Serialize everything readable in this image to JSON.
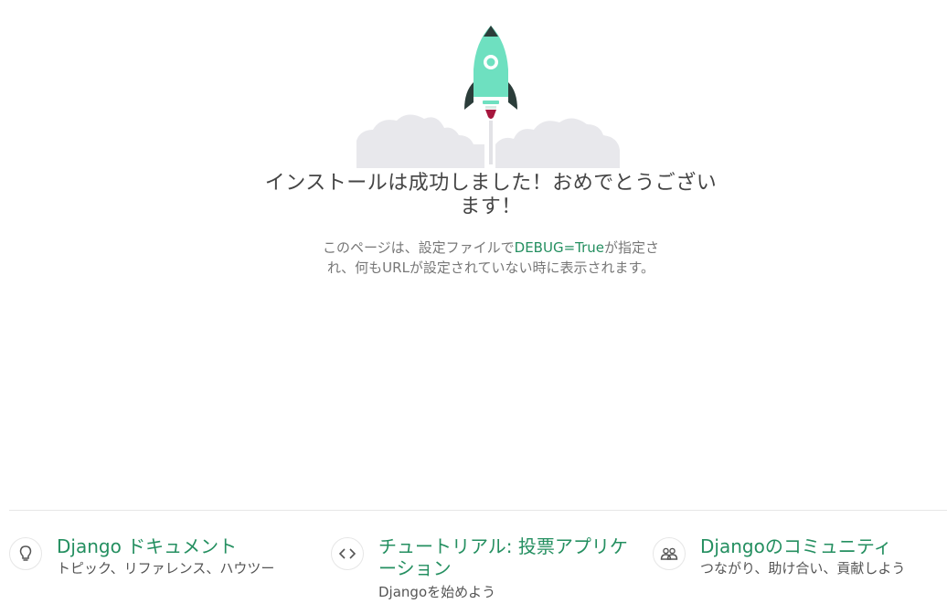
{
  "hero": {
    "icon": "rocket-icon",
    "rocket_body_color": "#6ee0c0",
    "rocket_fin_color": "#2b3d3a",
    "flame_color": "#a6163d",
    "cloud_color": "#e8e8ec"
  },
  "title": {
    "line1": "インストールは成功しました！おめでとうござい",
    "line2": "ます！"
  },
  "subtitle": {
    "part1": "このページは、設定ファイルで",
    "code": "DEBUG=True",
    "part2": "が指定さ",
    "line2": "れ、何もURLが設定されていない時に表示されます。"
  },
  "links": [
    {
      "icon": "lightbulb-icon",
      "title": "Django ドキュメント",
      "description": "トピック、リファレンス、ハウツー"
    },
    {
      "icon": "code-icon",
      "title_line1": "チュートリアル: 投票アプリケ",
      "title_line2": "ーション",
      "description": "Djangoを始めよう"
    },
    {
      "icon": "community-icon",
      "title": "Djangoのコミュニティ",
      "description": "つながり、助け合い、貢献しよう"
    }
  ],
  "colors": {
    "accent": "#248f60",
    "text": "#444444",
    "muted": "#777777"
  }
}
